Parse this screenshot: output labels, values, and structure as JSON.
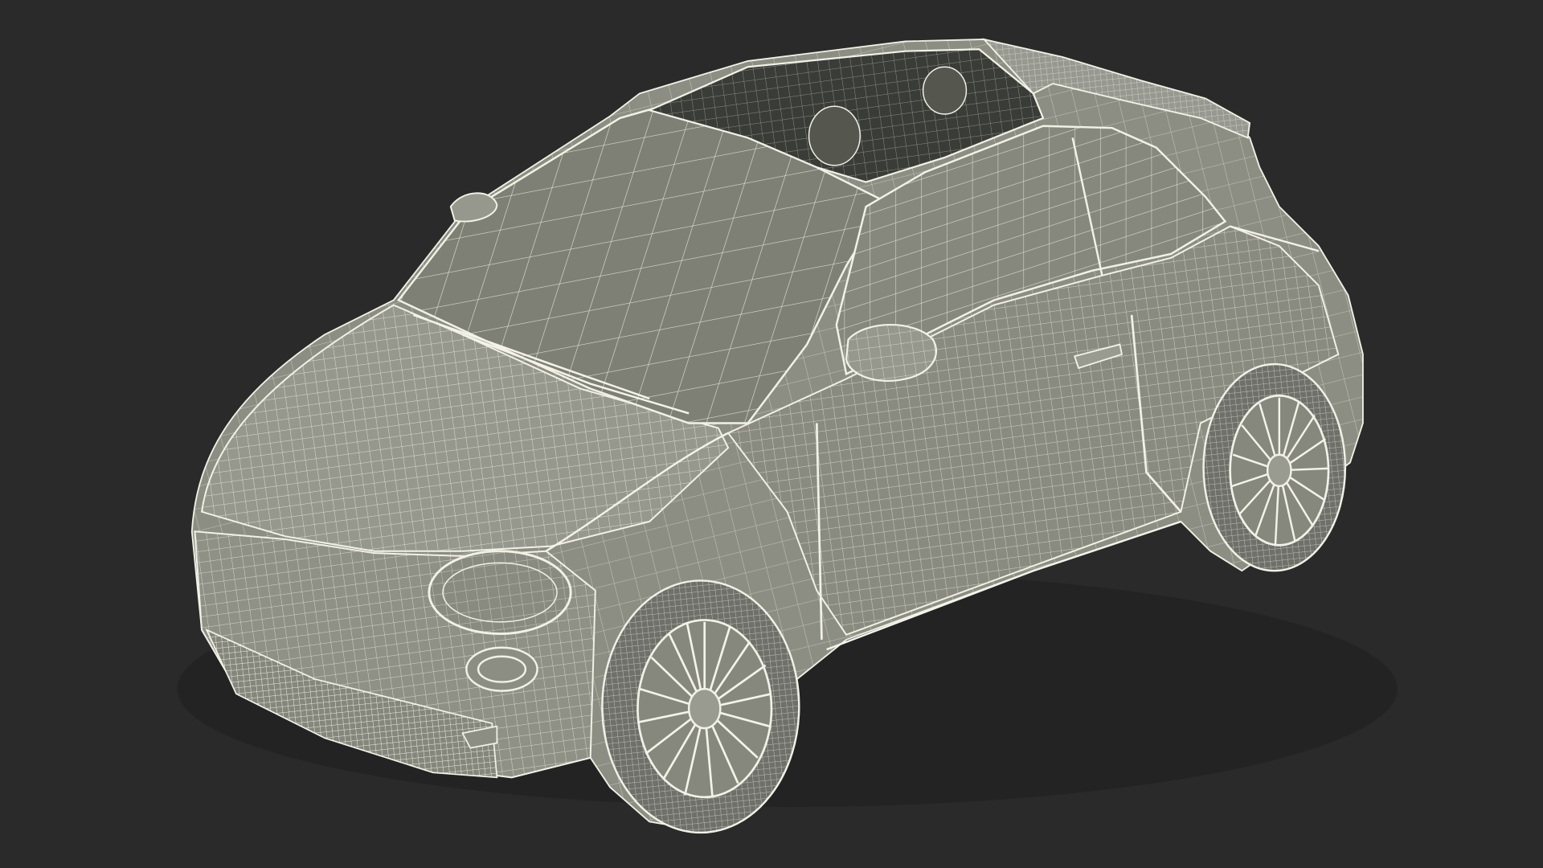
{
  "scene": {
    "subject": "car-wireframe",
    "colors": {
      "background": "#2a2a2a",
      "body_fill": "#8d8e83",
      "body_fill_light": "#9a9b90",
      "glass_fill": "#7e8076",
      "interior_fill": "#3a3c38",
      "tire_fill": "#6f706a",
      "wire": "#efefe4",
      "wire_dense": "#f4f3ea"
    }
  }
}
